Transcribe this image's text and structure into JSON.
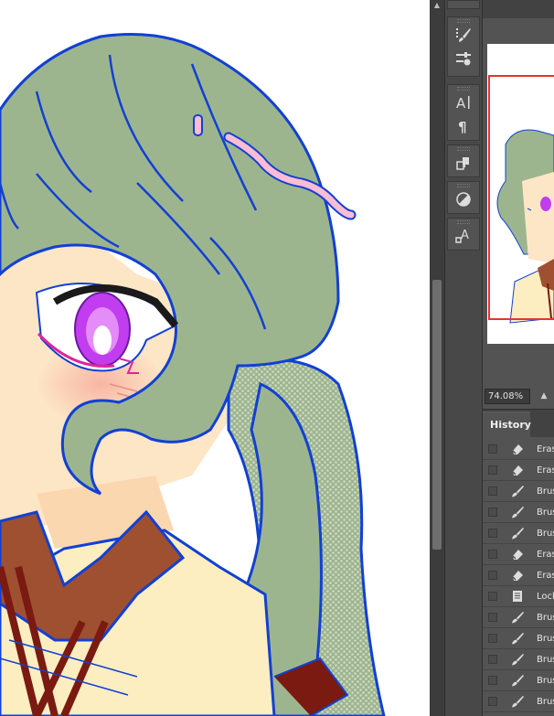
{
  "navigator": {
    "zoom": "74.08%",
    "zoom_out_icon": "triangle-up-icon"
  },
  "history": {
    "tab_label": "History",
    "items": [
      {
        "label": "Eras",
        "icon": "eraser-icon"
      },
      {
        "label": "Eras",
        "icon": "eraser-icon"
      },
      {
        "label": "Brus",
        "icon": "brush-icon"
      },
      {
        "label": "Brus",
        "icon": "brush-icon"
      },
      {
        "label": "Brus",
        "icon": "brush-icon"
      },
      {
        "label": "Eras",
        "icon": "eraser-icon"
      },
      {
        "label": "Eras",
        "icon": "eraser-icon"
      },
      {
        "label": "Lock",
        "icon": "document-icon"
      },
      {
        "label": "Brus",
        "icon": "brush-icon"
      },
      {
        "label": "Brus",
        "icon": "brush-icon"
      },
      {
        "label": "Brus",
        "icon": "brush-icon"
      },
      {
        "label": "Brus",
        "icon": "brush-icon"
      },
      {
        "label": "Brus",
        "icon": "brush-icon"
      }
    ]
  },
  "tools": [
    {
      "group": 1,
      "icon": "brush-presets-icon"
    },
    {
      "group": 1,
      "icon": "brush-settings-icon"
    },
    {
      "group": 2,
      "icon": "character-icon"
    },
    {
      "group": 2,
      "icon": "paragraph-icon"
    },
    {
      "group": 3,
      "icon": "clone-source-icon"
    },
    {
      "group": 4,
      "icon": "adjustments-icon"
    },
    {
      "group": 5,
      "icon": "character-styles-icon"
    }
  ],
  "colors": {
    "hair": "#9db58e",
    "line": "#1140d4",
    "skin": "#fde6c6",
    "eye": "#c23cf0",
    "collar": "#9e5030",
    "sweater": "#fdeec2",
    "clip": "#fbbdd3",
    "panel": "#535353",
    "selection": "#e8332d"
  }
}
